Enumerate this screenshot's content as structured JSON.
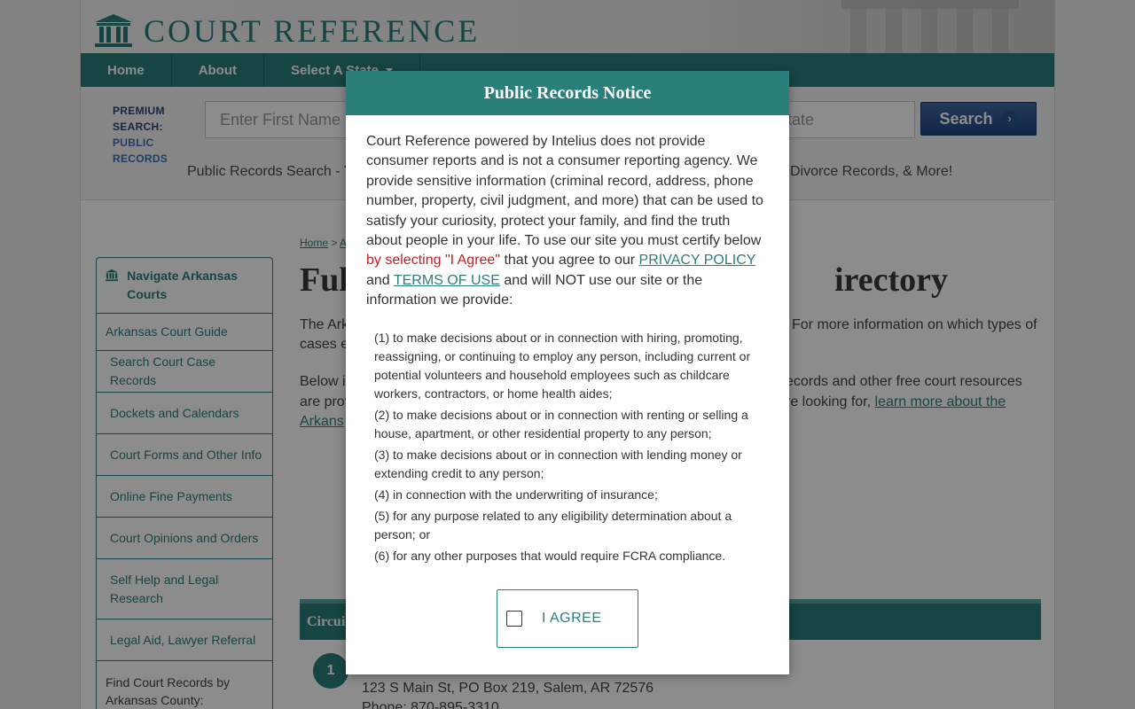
{
  "header": {
    "logo_text": "COURT REFERENCE"
  },
  "nav": {
    "items": [
      {
        "label": "Home"
      },
      {
        "label": "About"
      },
      {
        "label": "Select A State"
      }
    ]
  },
  "premium_search": {
    "label_line1": "PREMIUM SEARCH:",
    "label_line2": "PUBLIC RECORDS",
    "first_name_placeholder": "Enter First Name",
    "state_placeholder": "tate",
    "search_button": "Search",
    "tagline_left": "Public Records Search - Y",
    "tagline_right": "Divorce Records, & More!"
  },
  "sidebar": {
    "heading": "Navigate Arkansas Courts",
    "items": [
      "Arkansas Court Guide",
      "Search Court Case Records",
      "Dockets and Calendars",
      "Court Forms and Other Info",
      "Online Fine Payments",
      "Court Opinions and Orders",
      "Self Help and Legal Research",
      "Legal Aid, Lawyer Referral",
      "Find Court Records by Arkansas County:"
    ]
  },
  "main": {
    "breadcrumb_home": "Home",
    "breadcrumb_sep": ">",
    "breadcrumb_next": "A",
    "title_left": "Ful",
    "title_right": "irectory",
    "para1_left": "The Ark",
    "para1_left2": "cases e",
    "para1_right": "For more information on which types of",
    "para2_left1": "Below i",
    "para2_left2": "are prov",
    "para2_left3": "Arkans",
    "para2_right1": "ecords and other free court resources",
    "para2_right2": "re looking for,",
    "para2_link": "learn more about the",
    "circuit_label": "Circui",
    "entry_number": "1",
    "entry_address": "123 S Main St, PO Box 219, Salem, AR 72576",
    "entry_phone": "Phone: 870-895-3310"
  },
  "modal": {
    "title": "Public Records Notice",
    "intro_1": "Court Reference powered by Intelius does not provide consumer reports and is not a consumer reporting agency. We provide sensitive information (criminal record, address, phone number, property, civil judgment, and more) that can be used to satisfy your curiosity, protect your family, and find the truth about people in your life. To use our site you must certify below ",
    "intro_red": "by selecting \"I Agree\"",
    "intro_2": " that you agree to our ",
    "privacy_link": "PRIVACY POLICY",
    "intro_3": " and ",
    "terms_link": "TERMS OF USE",
    "intro_4": " and will NOT use our site or the information we provide:",
    "purposes": [
      "(1) to make decisions about or in connection with hiring, promoting, reassigning, or continuing to employ any person, including current or potential volunteers and household employees such as childcare workers, contractors, or home health aides;",
      "(2) to make decisions about or in connection with renting or selling a house, apartment, or other residential property to any person;",
      "(3) to make decisions about or in connection with lending money or extending credit to any person;",
      "(4) in connection with the underwriting of insurance;",
      "(5) for any purpose related to any eligibility determination about a person; or",
      "(6) for any other purposes that would require FCRA compliance."
    ],
    "agree_label": "I AGREE"
  },
  "colors": {
    "brand_teal": "#2b7f7b",
    "search_blue": "#1f4683",
    "notice_red": "#d01b1b"
  }
}
